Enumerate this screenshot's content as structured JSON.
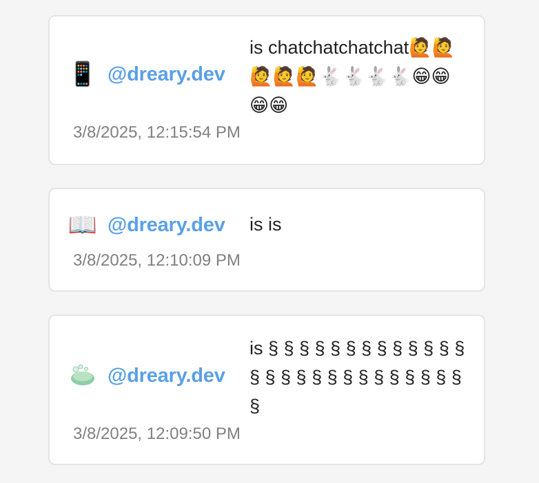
{
  "posts": [
    {
      "icon_name": "mobile-phone-icon",
      "icon_glyph": "📱",
      "handle": "@dreary.dev",
      "message": "is chatchatchatchat🙋🙋🙋🙋🙋🐇🐇🐇🐇😁😁😁😁",
      "timestamp": "3/8/2025, 12:15:54 PM"
    },
    {
      "icon_name": "open-book-icon",
      "icon_glyph": "📖",
      "handle": "@dreary.dev",
      "message": "is is",
      "timestamp": "3/8/2025, 12:10:09 PM"
    },
    {
      "icon_name": "soap-icon",
      "icon_glyph": "",
      "handle": "@dreary.dev",
      "message": "is § § § § § § § § § § § § § § § § § § § § § § § § § § § §",
      "timestamp": "3/8/2025, 12:09:50 PM"
    }
  ],
  "colors": {
    "handle": "#5aa0e6",
    "timestamp": "#808080",
    "text": "#222222",
    "card_border": "#e4e4e4",
    "background": "#f5f5f5"
  }
}
